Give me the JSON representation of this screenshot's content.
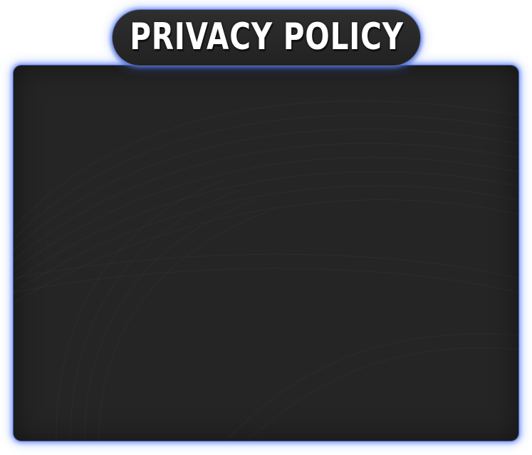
{
  "dialog": {
    "title": "PRIVACY POLICY"
  },
  "colors": {
    "panel_background": "#252525",
    "glow_accent": "#5a82ff",
    "title_text": "#ffffff"
  }
}
